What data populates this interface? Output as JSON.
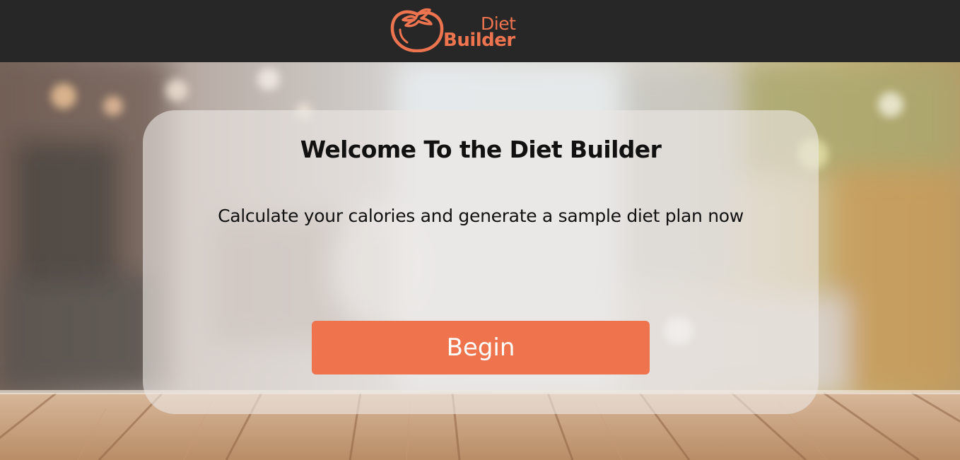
{
  "header": {
    "logo": {
      "icon": "tomato-icon",
      "word1": "Diet",
      "word2": "Builder",
      "color": "#ee7450"
    },
    "background_color": "#272727"
  },
  "background": {
    "description_icon": "blurred-cafe-with-wooden-table-photo"
  },
  "card": {
    "title": "Welcome To the Diet Builder",
    "subtitle": "Calculate your calories and generate a sample diet plan now",
    "begin_label": "Begin",
    "button_color": "#ef744e"
  }
}
